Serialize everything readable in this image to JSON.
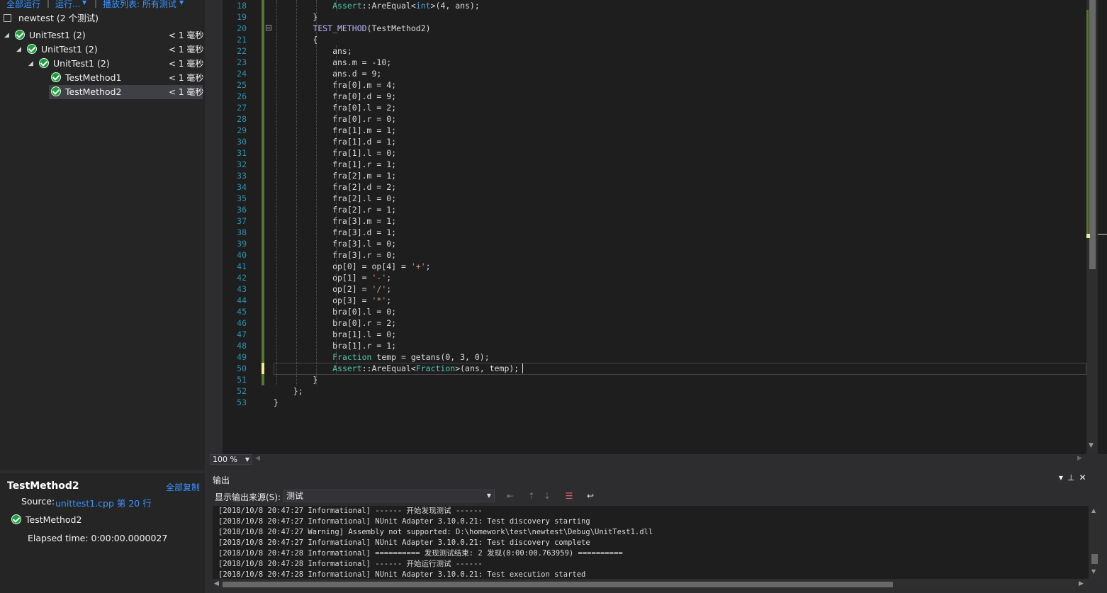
{
  "test_explorer": {
    "toolbar": {
      "run_all": "全部运行",
      "run": "运行...",
      "playlist": "播放列表: 所有测试"
    },
    "root": {
      "label": "newtest (2 个测试)"
    },
    "tree": [
      {
        "label": "UnitTest1 (2)",
        "duration": "< 1 毫秒"
      },
      {
        "label": "UnitTest1 (2)",
        "duration": "< 1 毫秒"
      },
      {
        "label": "UnitTest1 (2)",
        "duration": "< 1 毫秒"
      },
      {
        "label": "TestMethod1",
        "duration": "< 1 毫秒"
      },
      {
        "label": "TestMethod2",
        "duration": "< 1 毫秒"
      }
    ],
    "details": {
      "title": "TestMethod2",
      "copy_all": "全部复制",
      "source_label": "Source:",
      "source_link": "unittest1.cpp 第 20 行",
      "result_name": "TestMethod2",
      "elapsed": "Elapsed time: 0:00:00.0000027"
    }
  },
  "editor": {
    "zoom": "100 %",
    "lines": [
      {
        "n": "18",
        "parts": [
          [
            "\t\t\t",
            ""
          ],
          [
            "Assert",
            "t"
          ],
          [
            "::AreEqual<",
            ""
          ],
          [
            "int",
            "b"
          ],
          [
            ">(4, ans);",
            ""
          ]
        ]
      },
      {
        "n": "19",
        "parts": [
          [
            "\t\t}",
            ""
          ]
        ]
      },
      {
        "n": "20",
        "parts": [
          [
            "\t\t",
            ""
          ],
          [
            "TEST_METHOD",
            "m"
          ],
          [
            "(TestMethod2)",
            ""
          ]
        ]
      },
      {
        "n": "21",
        "parts": [
          [
            "\t\t{",
            ""
          ]
        ]
      },
      {
        "n": "22",
        "parts": [
          [
            "\t\t\tans;",
            ""
          ]
        ]
      },
      {
        "n": "23",
        "parts": [
          [
            "\t\t\tans.m = -10;",
            ""
          ]
        ]
      },
      {
        "n": "24",
        "parts": [
          [
            "\t\t\tans.d = 9;",
            ""
          ]
        ]
      },
      {
        "n": "25",
        "parts": [
          [
            "\t\t\tfra[0].m = 4;",
            ""
          ]
        ]
      },
      {
        "n": "26",
        "parts": [
          [
            "\t\t\tfra[0].d = 9;",
            ""
          ]
        ]
      },
      {
        "n": "27",
        "parts": [
          [
            "\t\t\tfra[0].l = 2;",
            ""
          ]
        ]
      },
      {
        "n": "28",
        "parts": [
          [
            "\t\t\tfra[0].r = 0;",
            ""
          ]
        ]
      },
      {
        "n": "29",
        "parts": [
          [
            "\t\t\tfra[1].m = 1;",
            ""
          ]
        ]
      },
      {
        "n": "30",
        "parts": [
          [
            "\t\t\tfra[1].d = 1;",
            ""
          ]
        ]
      },
      {
        "n": "31",
        "parts": [
          [
            "\t\t\tfra[1].l = 0;",
            ""
          ]
        ]
      },
      {
        "n": "32",
        "parts": [
          [
            "\t\t\tfra[1].r = 1;",
            ""
          ]
        ]
      },
      {
        "n": "33",
        "parts": [
          [
            "\t\t\tfra[2].m = 1;",
            ""
          ]
        ]
      },
      {
        "n": "34",
        "parts": [
          [
            "\t\t\tfra[2].d = 2;",
            ""
          ]
        ]
      },
      {
        "n": "35",
        "parts": [
          [
            "\t\t\tfra[2].l = 0;",
            ""
          ]
        ]
      },
      {
        "n": "36",
        "parts": [
          [
            "\t\t\tfra[2].r = 1;",
            ""
          ]
        ]
      },
      {
        "n": "37",
        "parts": [
          [
            "\t\t\tfra[3].m = 1;",
            ""
          ]
        ]
      },
      {
        "n": "38",
        "parts": [
          [
            "\t\t\tfra[3].d = 1;",
            ""
          ]
        ]
      },
      {
        "n": "39",
        "parts": [
          [
            "\t\t\tfra[3].l = 0;",
            ""
          ]
        ]
      },
      {
        "n": "40",
        "parts": [
          [
            "\t\t\tfra[3].r = 0;",
            ""
          ]
        ]
      },
      {
        "n": "41",
        "parts": [
          [
            "\t\t\top[0] = op[4] = ",
            ""
          ],
          [
            "'+'",
            "s"
          ],
          [
            ";",
            ""
          ]
        ]
      },
      {
        "n": "42",
        "parts": [
          [
            "\t\t\top[1] = ",
            ""
          ],
          [
            "'-'",
            "s"
          ],
          [
            ";",
            ""
          ]
        ]
      },
      {
        "n": "43",
        "parts": [
          [
            "\t\t\top[2] = ",
            ""
          ],
          [
            "'/'",
            "s"
          ],
          [
            ";",
            ""
          ]
        ]
      },
      {
        "n": "44",
        "parts": [
          [
            "\t\t\top[3] = ",
            ""
          ],
          [
            "'*'",
            "s"
          ],
          [
            ";",
            ""
          ]
        ]
      },
      {
        "n": "45",
        "parts": [
          [
            "\t\t\tbra[0].l = 0;",
            ""
          ]
        ]
      },
      {
        "n": "46",
        "parts": [
          [
            "\t\t\tbra[0].r = 2;",
            ""
          ]
        ]
      },
      {
        "n": "47",
        "parts": [
          [
            "\t\t\tbra[1].l = 0;",
            ""
          ]
        ]
      },
      {
        "n": "48",
        "parts": [
          [
            "\t\t\tbra[1].r = 1;",
            ""
          ]
        ]
      },
      {
        "n": "49",
        "parts": [
          [
            "\t\t\t",
            ""
          ],
          [
            "Fraction",
            "t"
          ],
          [
            " temp = getans(0, 3, 0);",
            ""
          ]
        ]
      },
      {
        "n": "50",
        "parts": [
          [
            "\t\t\t",
            ""
          ],
          [
            "Assert",
            "t"
          ],
          [
            "::AreEqual<",
            ""
          ],
          [
            "Fraction",
            "t"
          ],
          [
            ">(ans, temp);",
            ""
          ]
        ]
      },
      {
        "n": "51",
        "parts": [
          [
            "\t\t}",
            ""
          ]
        ]
      },
      {
        "n": "52",
        "parts": [
          [
            "\t};",
            ""
          ]
        ]
      },
      {
        "n": "53",
        "parts": [
          [
            "}",
            ""
          ]
        ]
      }
    ]
  },
  "output": {
    "title": "输出",
    "source_label": "显示输出来源(S):",
    "source_value": "测试",
    "lines": [
      "[2018/10/8 20:47:27 Informational] ------ 开始发现测试 ------",
      "[2018/10/8 20:47:27 Informational] NUnit Adapter 3.10.0.21: Test discovery starting",
      "[2018/10/8 20:47:27 Warning] Assembly not supported: D:\\homework\\test\\newtest\\Debug\\UnitTest1.dll",
      "[2018/10/8 20:47:27 Informational] NUnit Adapter 3.10.0.21: Test discovery complete",
      "[2018/10/8 20:47:28 Informational] ========== 发现测试结束: 2 发现(0:00:00.763959) ==========",
      "[2018/10/8 20:47:28 Informational] ------ 开始运行测试 ------",
      "[2018/10/8 20:47:28 Informational] NUnit Adapter 3.10.0.21: Test execution started"
    ]
  },
  "colors": {
    "accent_link": "#3794ff",
    "pass_green": "#1e9e3c",
    "line_number": "#2b91af",
    "change_bar": "#577430"
  }
}
